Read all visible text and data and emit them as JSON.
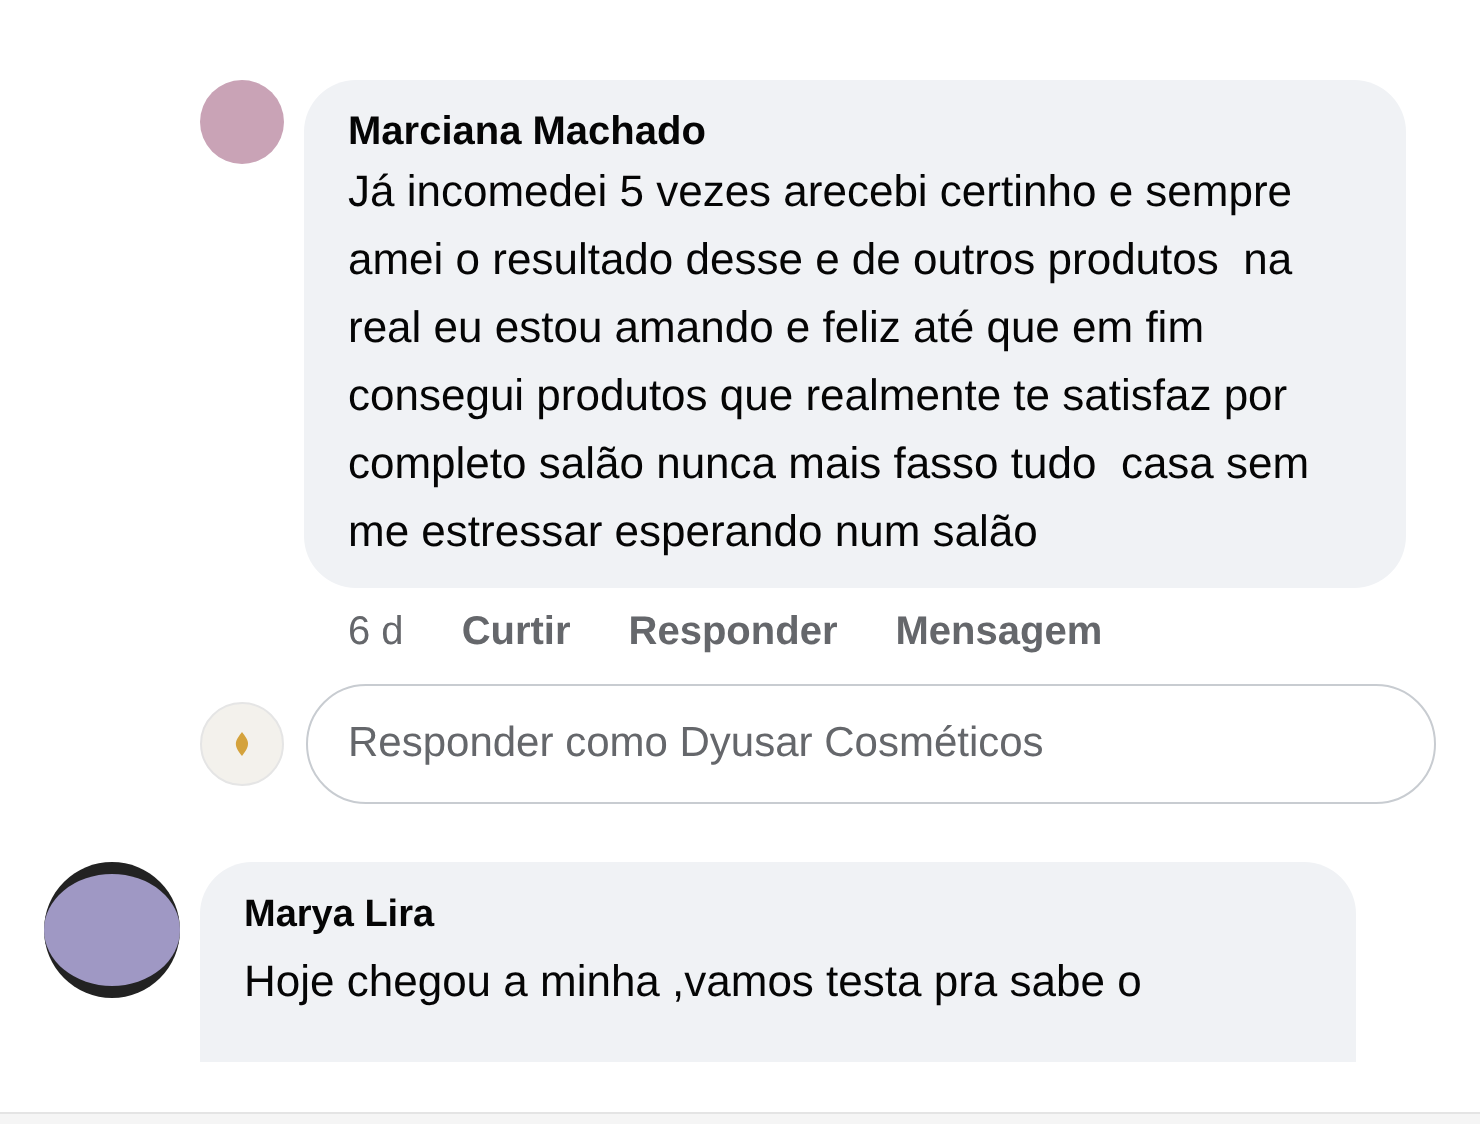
{
  "comments": [
    {
      "author": "Marciana Machado",
      "text": "Já incomedei 5 vezes arecebi certinho e sempre amei o resultado desse e de outros produtos  na real eu estou amando e feliz até que em fim consegui produtos que realmente te satisfaz por completo salão nunca mais fasso tudo  casa sem me estressar esperando num salão",
      "time": "6 d",
      "actions": [
        "Curtir",
        "Responder",
        "Mensagem"
      ]
    }
  ],
  "reply_field": {
    "placeholder": "Responder como Dyusar Cosméticos"
  },
  "next_comment": {
    "author": "Marya Lira",
    "text": "Hoje chegou a minha ,vamos testa pra sabe o"
  }
}
